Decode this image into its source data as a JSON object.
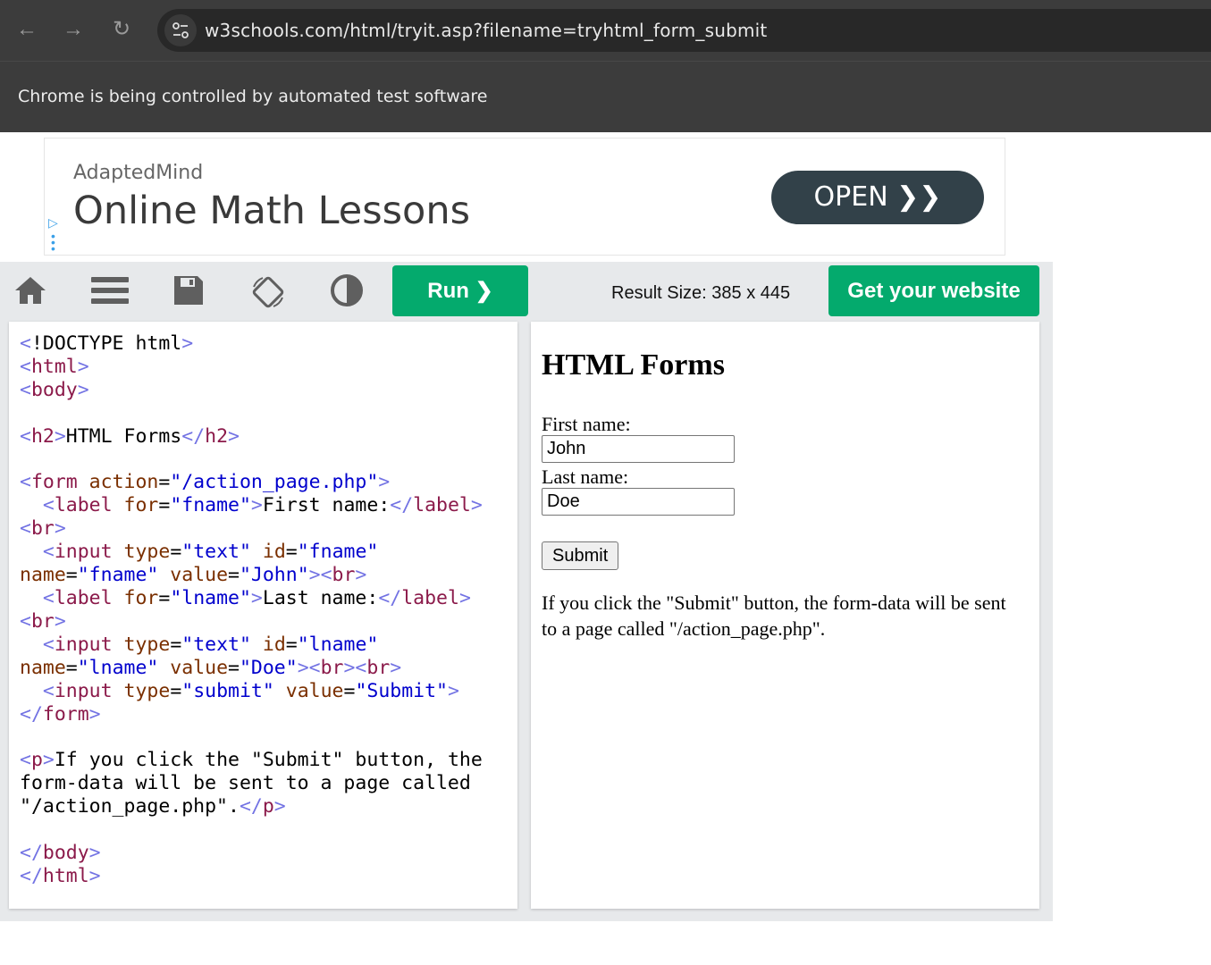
{
  "browser": {
    "back_icon": "←",
    "forward_icon": "→",
    "reload_icon": "↻",
    "site_info_icon": "⚙",
    "url": "w3schools.com/html/tryit.asp?filename=tryhtml_form_submit",
    "infobar_text": "Chrome is being controlled by automated test software"
  },
  "ad": {
    "brand": "AdaptedMind",
    "title": "Online Math Lessons",
    "open_label": "OPEN  ❯❯"
  },
  "toolbar": {
    "run_label": "Run  ❯",
    "result_size": "Result Size: 385 x 445",
    "get_website_label": "Get your website"
  },
  "result": {
    "heading": "HTML Forms",
    "first_name_label": "First name:",
    "first_name_value": "John",
    "last_name_label": "Last name:",
    "last_name_value": "Doe",
    "submit_label": "Submit",
    "paragraph": "If you click the \"Submit\" button, the form-data will be sent to a page called \"/action_page.php\"."
  },
  "colors": {
    "accent_green": "#04aa6d",
    "ad_button": "#324149",
    "chrome_dark": "#3c3c3c"
  }
}
